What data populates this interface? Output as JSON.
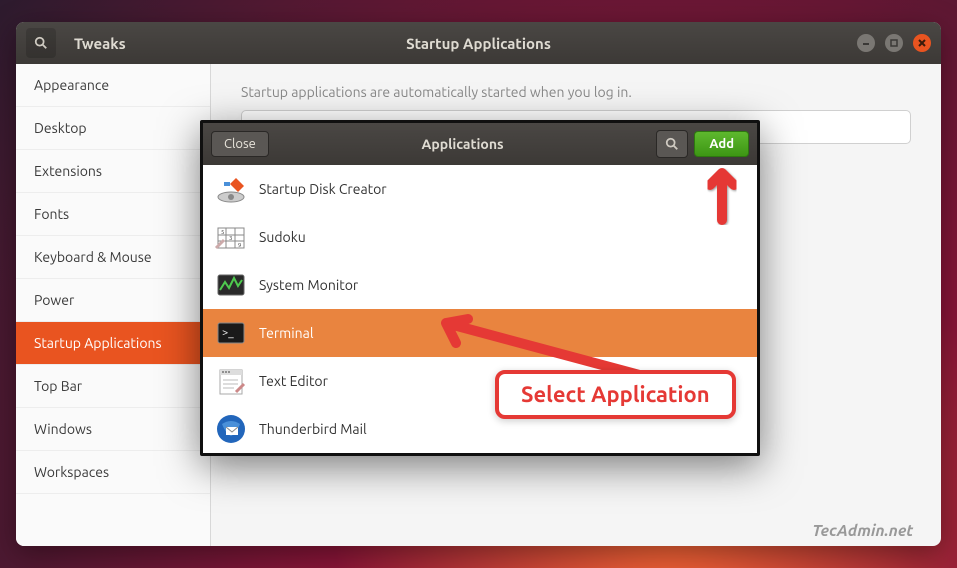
{
  "window": {
    "app_name": "Tweaks",
    "title": "Startup Applications"
  },
  "sidebar": {
    "items": [
      {
        "label": "Appearance"
      },
      {
        "label": "Desktop"
      },
      {
        "label": "Extensions"
      },
      {
        "label": "Fonts"
      },
      {
        "label": "Keyboard & Mouse"
      },
      {
        "label": "Power"
      },
      {
        "label": "Startup Applications"
      },
      {
        "label": "Top Bar"
      },
      {
        "label": "Windows"
      },
      {
        "label": "Workspaces"
      }
    ],
    "active_index": 6
  },
  "content": {
    "description": "Startup applications are automatically started when you log in."
  },
  "modal": {
    "close_label": "Close",
    "title": "Applications",
    "add_label": "Add",
    "apps": [
      {
        "label": "Startup Disk Creator",
        "icon": "disk-creator"
      },
      {
        "label": "Sudoku",
        "icon": "sudoku"
      },
      {
        "label": "System Monitor",
        "icon": "monitor"
      },
      {
        "label": "Terminal",
        "icon": "terminal"
      },
      {
        "label": "Text Editor",
        "icon": "editor"
      },
      {
        "label": "Thunderbird Mail",
        "icon": "thunderbird"
      }
    ],
    "selected_index": 3
  },
  "annotations": {
    "callout": "Select Application"
  },
  "watermark": "TecAdmin.net"
}
